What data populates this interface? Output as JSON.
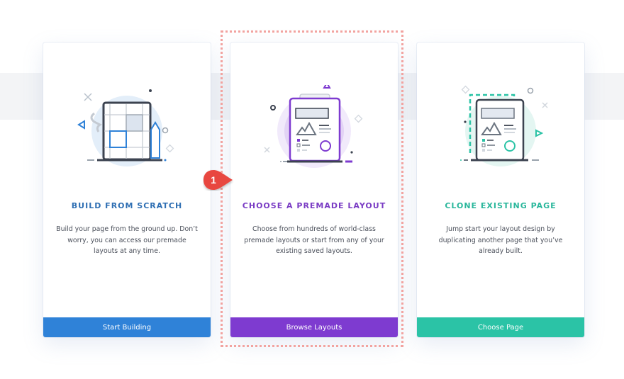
{
  "cards": [
    {
      "title": "BUILD FROM SCRATCH",
      "description": "Build your page from the ground up. Don’t worry, you can access our premade layouts at any time.",
      "button_label": "Start Building",
      "accent": "#2f82d8",
      "title_color": "#2f6fb3",
      "icon": "blueprint-grid-icon"
    },
    {
      "title": "CHOOSE A PREMADE LAYOUT",
      "description": "Choose from hundreds of world-class premade layouts or start from any of your existing saved layouts.",
      "button_label": "Browse Layouts",
      "accent": "#7e3bd0",
      "title_color": "#7a3cc4",
      "icon": "layout-document-icon"
    },
    {
      "title": "CLONE EXISTING PAGE",
      "description": "Jump start your layout design by duplicating another page that you’ve already built.",
      "button_label": "Choose Page",
      "accent": "#2bc3a6",
      "title_color": "#2bb79c",
      "icon": "clone-document-icon"
    }
  ],
  "annotation": {
    "step_number": "1",
    "marker_color": "#e8473f",
    "frame_color": "#f2a3a0"
  }
}
